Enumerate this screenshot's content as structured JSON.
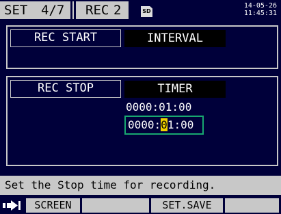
{
  "header": {
    "mode": "SET",
    "page": "4/7",
    "tab": "REC",
    "tab_number": "2",
    "sd_label": "SD",
    "date": "14-05-26",
    "time": "11:45:31"
  },
  "rec_start": {
    "label": "REC START",
    "value": "INTERVAL"
  },
  "rec_stop": {
    "label": "REC STOP",
    "value": "TIMER",
    "timer_current": "0000:01:00",
    "timer_edit_before": "0000:",
    "timer_edit_cursor": "0",
    "timer_edit_after": "1:00"
  },
  "help_text": "Set the Stop time for recording.",
  "function_keys": {
    "f1": "SCREEN",
    "f2": "",
    "f3": "SET.SAVE",
    "f4": ""
  },
  "icons": {
    "exit": "exit-arrow-icon",
    "sd": "sd-card-icon"
  },
  "colors": {
    "background": "#00003a",
    "panel": "#c8c8c8",
    "edit_border": "#18a870",
    "cursor": "#f0d000"
  }
}
